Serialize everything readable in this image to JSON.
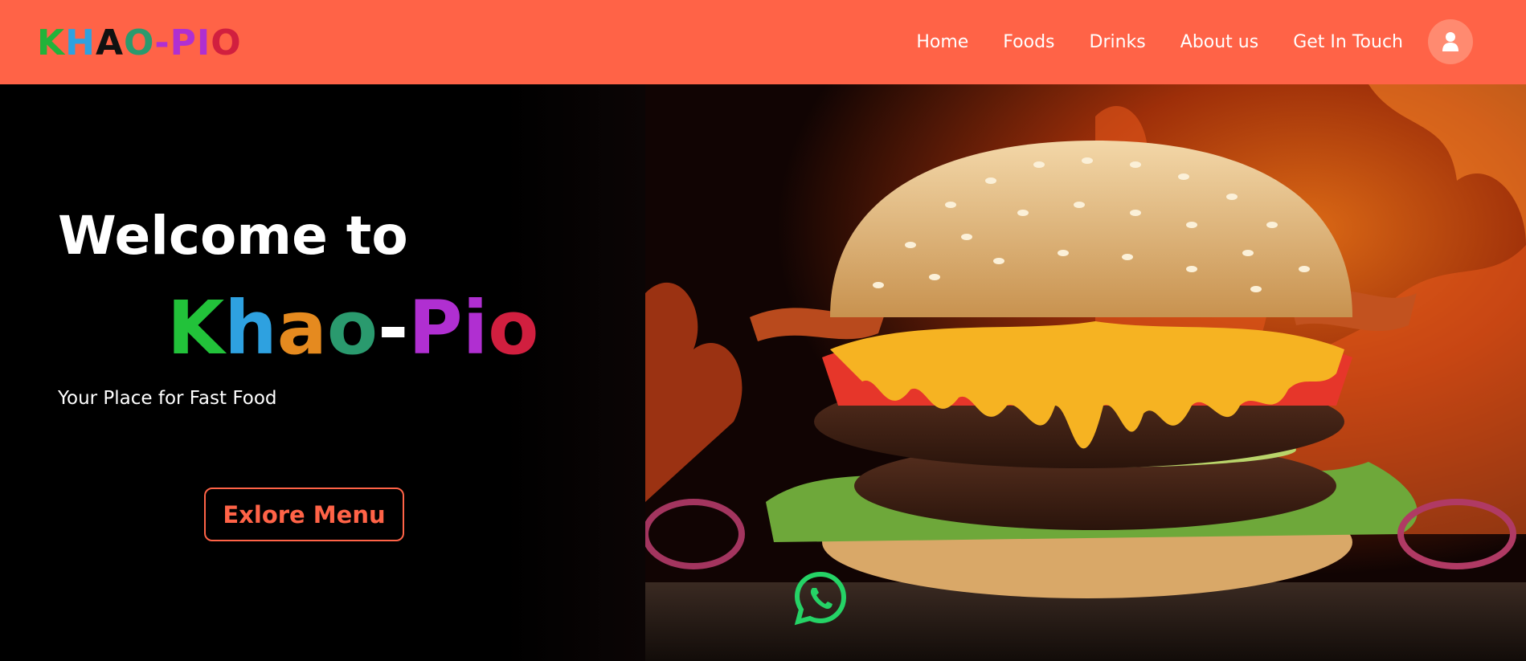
{
  "header": {
    "logo_letters": [
      {
        "ch": "K",
        "color": "#22b33a"
      },
      {
        "ch": "H",
        "color": "#2ea1e0"
      },
      {
        "ch": "A",
        "color": "#111111"
      },
      {
        "ch": "O",
        "color": "#2a9a6e"
      },
      {
        "ch": "-",
        "color": "#b02fd1"
      },
      {
        "ch": "P",
        "color": "#b02fd1"
      },
      {
        "ch": "I",
        "color": "#b02fd1"
      },
      {
        "ch": "O",
        "color": "#d11f3f"
      }
    ],
    "nav": [
      "Home",
      "Foods",
      "Drinks",
      "About us",
      "Get In Touch"
    ],
    "user_icon": "user-icon",
    "bg_color": "#ff6347"
  },
  "hero": {
    "welcome": "Welcome to",
    "brand_letters": [
      {
        "ch": "K",
        "color": "#22c23a"
      },
      {
        "ch": "h",
        "color": "#2ea1e0"
      },
      {
        "ch": "a",
        "color": "#e58a1f"
      },
      {
        "ch": "o",
        "color": "#2a9a6e"
      },
      {
        "ch": "-",
        "color": "#ffffff"
      },
      {
        "ch": "P",
        "color": "#b02fd1"
      },
      {
        "ch": "i",
        "color": "#b02fd1"
      },
      {
        "ch": "o",
        "color": "#d11f3f"
      }
    ],
    "tagline": "Your Place for Fast Food",
    "button_label": "Exlore Menu",
    "accent_color": "#ff6347",
    "image": "burger-photo",
    "whatsapp_icon": "whatsapp-icon"
  }
}
